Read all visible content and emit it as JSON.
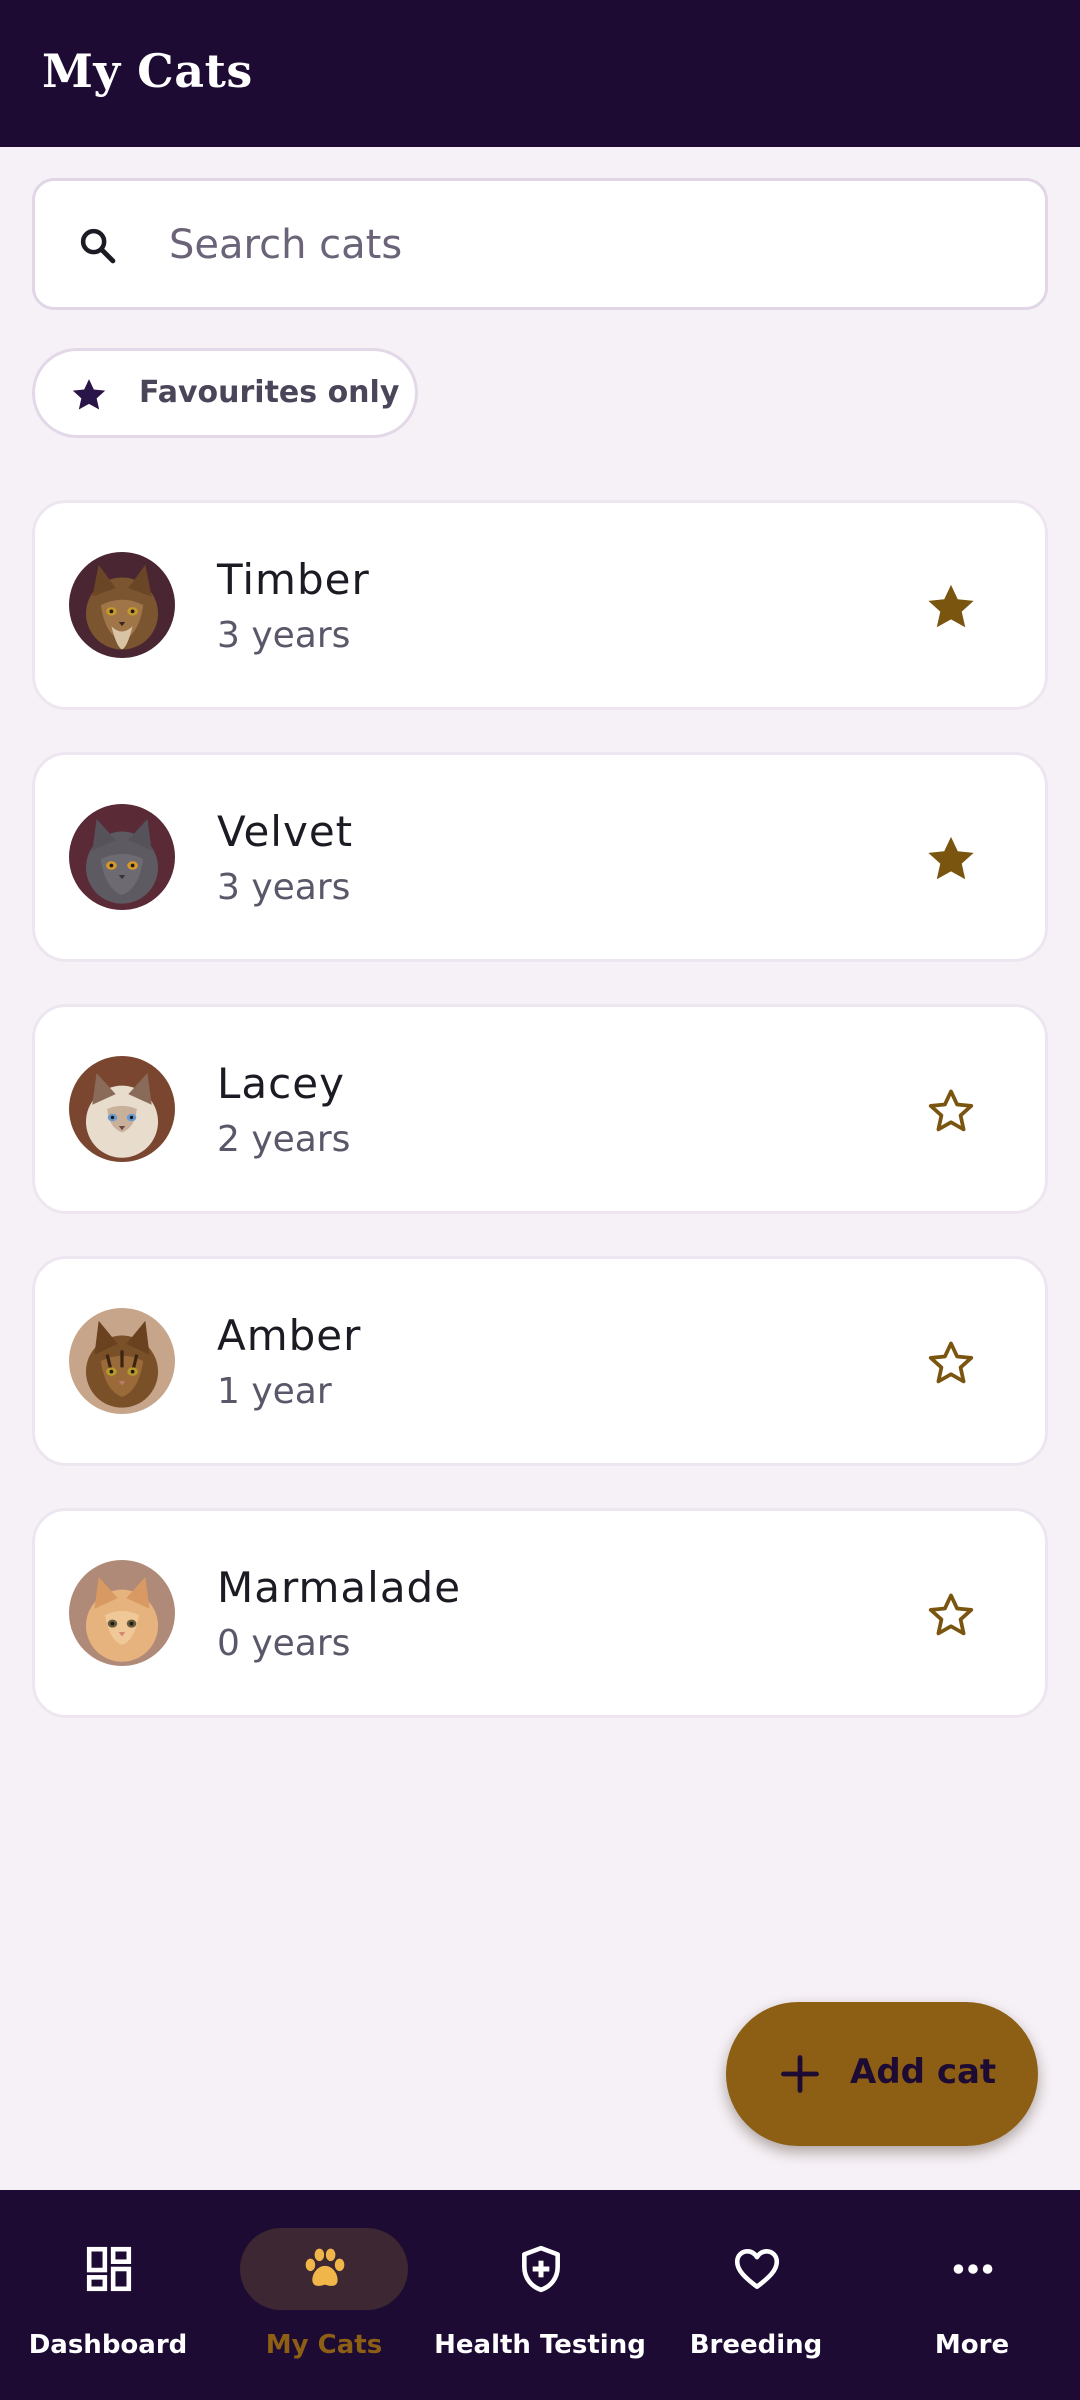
{
  "header": {
    "title": "My Cats"
  },
  "search": {
    "placeholder": "Search cats",
    "value": ""
  },
  "filter": {
    "label": "Favourites only",
    "selected": false
  },
  "cats": [
    {
      "name": "Timber",
      "age": "3 years",
      "favourite": true
    },
    {
      "name": "Velvet",
      "age": "3 years",
      "favourite": true
    },
    {
      "name": "Lacey",
      "age": "2 years",
      "favourite": false
    },
    {
      "name": "Amber",
      "age": "1 year",
      "favourite": false
    },
    {
      "name": "Marmalade",
      "age": "0 years",
      "favourite": false
    }
  ],
  "fab": {
    "label": "Add cat",
    "icon": "plus-icon"
  },
  "nav": {
    "active": "My Cats",
    "items": [
      {
        "label": "Dashboard",
        "icon": "dashboard-icon"
      },
      {
        "label": "My Cats",
        "icon": "paw-icon"
      },
      {
        "label": "Health Testing",
        "icon": "shield-plus-icon"
      },
      {
        "label": "Breeding",
        "icon": "heart-icon"
      },
      {
        "label": "More",
        "icon": "more-horizontal-icon"
      }
    ]
  },
  "colors": {
    "appbar": "#1d0b33",
    "background": "#f6f1f6",
    "accent": "#8c5f14",
    "star": "#7a5510",
    "nav_active": "#8c5f14",
    "nav_active_icon": "#f0b64a"
  }
}
